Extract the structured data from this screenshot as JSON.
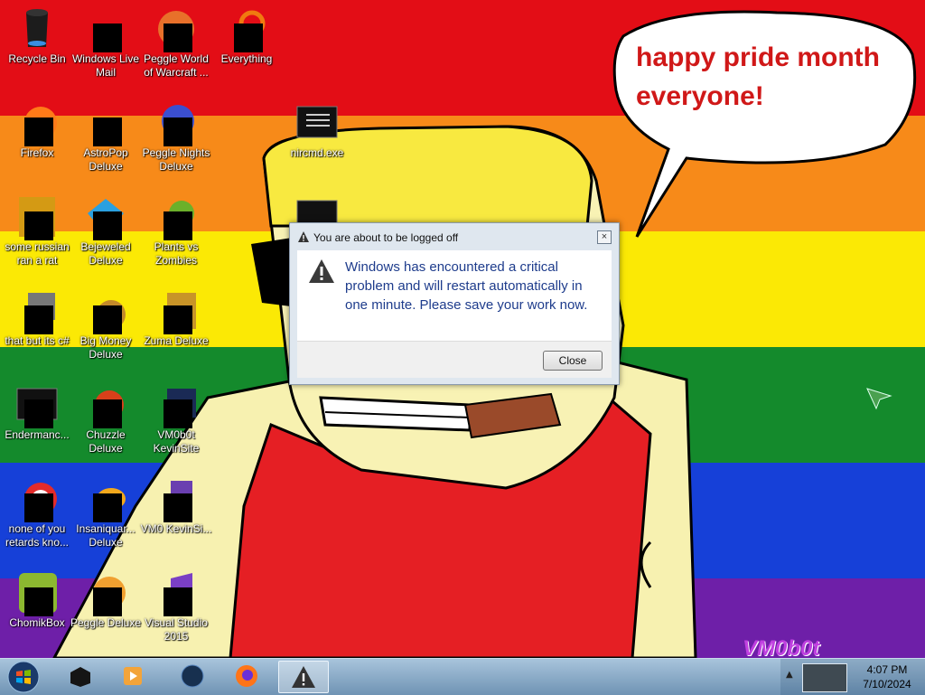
{
  "wallpaper": {
    "speech_bubble": "happy pride month everyone!",
    "watermark": "VM0b0t",
    "stripes": [
      "#e30d16",
      "#f78a19",
      "#fbe905",
      "#148a2c",
      "#1640d8",
      "#6e1fa8"
    ]
  },
  "icons": [
    {
      "id": "recycle-bin",
      "label": "Recycle Bin"
    },
    {
      "id": "windows-live-mail",
      "label": "Windows Live Mail"
    },
    {
      "id": "peggle-world-of-warcraft",
      "label": "Peggle World of Warcraft ..."
    },
    {
      "id": "everything",
      "label": "Everything"
    },
    {
      "id": "firefox",
      "label": "Firefox"
    },
    {
      "id": "astropop-deluxe",
      "label": "AstroPop Deluxe"
    },
    {
      "id": "peggle-nights-deluxe",
      "label": "Peggle Nights Deluxe"
    },
    {
      "id": "nircmd",
      "label": "nircmd.exe"
    },
    {
      "id": "some-russian",
      "label": "some russian ran a rat"
    },
    {
      "id": "bejeweled-deluxe",
      "label": "Bejeweled Deluxe"
    },
    {
      "id": "plants-vs-zombies",
      "label": "Plants vs Zombies"
    },
    {
      "id": "that-but-its-csharp",
      "label": "that but its c#"
    },
    {
      "id": "big-money-deluxe",
      "label": "Big Money Deluxe"
    },
    {
      "id": "zuma-deluxe",
      "label": "Zuma Deluxe"
    },
    {
      "id": "endermanch",
      "label": "Endermanc..."
    },
    {
      "id": "chuzzle-deluxe",
      "label": "Chuzzle Deluxe"
    },
    {
      "id": "vm0b0t-kevinsite",
      "label": "VM0b0t KevinSite"
    },
    {
      "id": "none-of-you",
      "label": "none of you retards kno..."
    },
    {
      "id": "insaniquarium-deluxe",
      "label": "Insaniquar... Deluxe"
    },
    {
      "id": "vm0-kevinsi",
      "label": "VM0 KevinSi..."
    },
    {
      "id": "chomikbox",
      "label": "ChomikBox"
    },
    {
      "id": "peggle-deluxe",
      "label": "Peggle Deluxe"
    },
    {
      "id": "visual-studio-2015",
      "label": "Visual Studio 2015"
    }
  ],
  "dialog": {
    "title": "You are about to be logged off",
    "message": "Windows has encountered a critical problem and will restart automatically in one minute. Please save your work now.",
    "close_label": "Close",
    "close_x": "×"
  },
  "taskbar": {
    "items": [
      "start-orb",
      "terminal",
      "media-player",
      "globe",
      "firefox",
      "logoff-warning"
    ],
    "tray_arrow": "▲",
    "clock": {
      "time": "4:07 PM",
      "date": "7/10/2024"
    }
  }
}
